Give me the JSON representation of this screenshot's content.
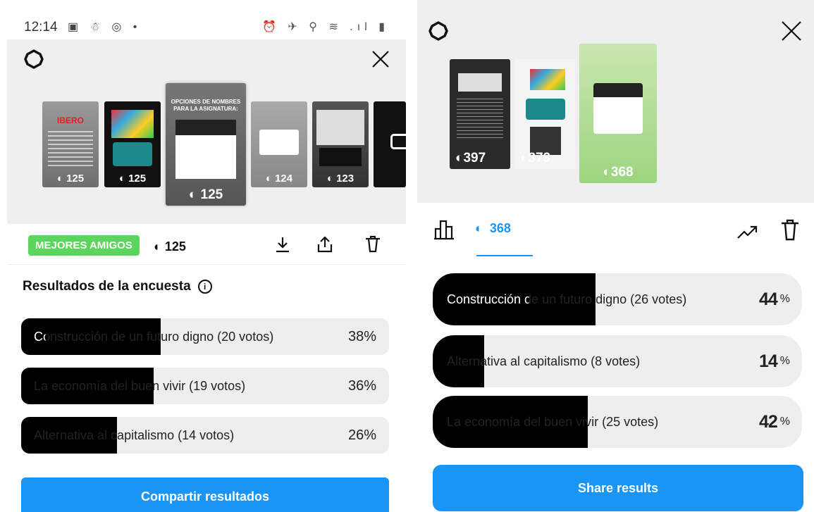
{
  "left": {
    "status_bar": {
      "time": "12:14",
      "left_icons": "▣ ☃ ◎ •",
      "right_icons": "⏰ ✈ ⚲ ≋ .ıl ▮"
    },
    "thumbs": [
      {
        "views": "125"
      },
      {
        "views": "125"
      },
      {
        "views": "125",
        "title": "OPCIONES DE NOMBRES PARA LA ASIGNATURA:"
      },
      {
        "views": "124"
      },
      {
        "views": "123"
      }
    ],
    "best_friends_badge": "MEJORES AMIGOS",
    "viewer_count": "125",
    "results_title": "Resultados de la encuesta",
    "info_glyph": "i",
    "options": [
      {
        "label": "Construcción de un futuro digno (20 votos)",
        "percent": "38%",
        "fraction": 0.38
      },
      {
        "label": "La economía del buen vivir (19 votos)",
        "percent": "36%",
        "fraction": 0.36
      },
      {
        "label": "Alternativa al capitalismo (14 votos)",
        "percent": "26%",
        "fraction": 0.26
      }
    ],
    "share_label": "Compartir resultados"
  },
  "right": {
    "thumbs": [
      {
        "views": "397"
      },
      {
        "views": "379"
      },
      {
        "views": "368"
      }
    ],
    "viewer_count": "368",
    "options": [
      {
        "label": "Construcción de un futuro digno (26 votes)",
        "percent": "44",
        "fraction": 0.44
      },
      {
        "label": "Alternativa al capitalismo (8 votes)",
        "percent": "14",
        "fraction": 0.14
      },
      {
        "label": "La economía del buen vivir (25 votes)",
        "percent": "42",
        "fraction": 0.42
      }
    ],
    "percent_sign": "%",
    "share_label": "Share results"
  },
  "colors": {
    "accent": "#1a95f5",
    "best_friends": "#5cd55c",
    "fill": "#000000",
    "track": "#eeeeee"
  }
}
